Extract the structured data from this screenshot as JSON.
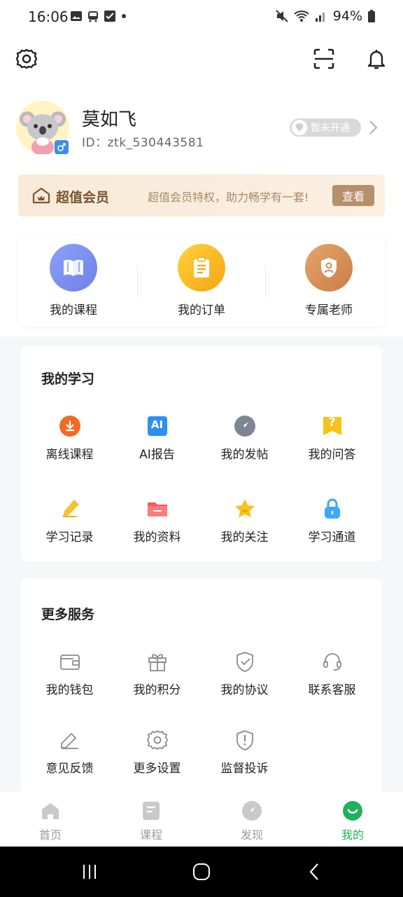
{
  "status_bar": {
    "time": "16:06",
    "battery": "94%"
  },
  "profile": {
    "name": "莫如飞",
    "id": "ID：ztk_530443581",
    "vip_status": "暂未开通"
  },
  "banner": {
    "title": "超值会员",
    "desc": "超值会员特权，助力畅学有一套!",
    "button": "查看"
  },
  "quick": [
    {
      "label": "我的课程",
      "icon": "book-icon",
      "color": "#7b8ff0"
    },
    {
      "label": "我的订单",
      "icon": "clipboard-icon",
      "color": "#f7b21e"
    },
    {
      "label": "专属老师",
      "icon": "teacher-shield-icon",
      "color": "#d9925a"
    }
  ],
  "study": {
    "title": "我的学习",
    "items": [
      {
        "label": "离线课程",
        "icon": "download-icon"
      },
      {
        "label": "AI报告",
        "icon": "ai-icon",
        "badge": "AI"
      },
      {
        "label": "我的发帖",
        "icon": "compass-icon"
      },
      {
        "label": "我的问答",
        "icon": "question-icon",
        "badge": "?"
      },
      {
        "label": "学习记录",
        "icon": "pencil-icon"
      },
      {
        "label": "我的资料",
        "icon": "folder-icon"
      },
      {
        "label": "我的关注",
        "icon": "star-icon"
      },
      {
        "label": "学习通道",
        "icon": "lock-icon"
      }
    ]
  },
  "services": {
    "title": "更多服务",
    "items": [
      {
        "label": "我的钱包",
        "icon": "wallet-icon"
      },
      {
        "label": "我的积分",
        "icon": "gift-icon"
      },
      {
        "label": "我的协议",
        "icon": "shield-check-icon"
      },
      {
        "label": "联系客服",
        "icon": "headset-icon"
      },
      {
        "label": "意见反馈",
        "icon": "feedback-icon"
      },
      {
        "label": "更多设置",
        "icon": "settings-icon"
      },
      {
        "label": "监督投诉",
        "icon": "complaint-shield-icon"
      }
    ]
  },
  "tabs": [
    {
      "label": "首页",
      "icon": "home-icon"
    },
    {
      "label": "课程",
      "icon": "course-icon"
    },
    {
      "label": "发现",
      "icon": "discover-icon"
    },
    {
      "label": "我的",
      "icon": "me-icon",
      "active": true
    }
  ],
  "colors": {
    "accent": "#1fb25a",
    "vip_brown": "#b68f6b"
  }
}
